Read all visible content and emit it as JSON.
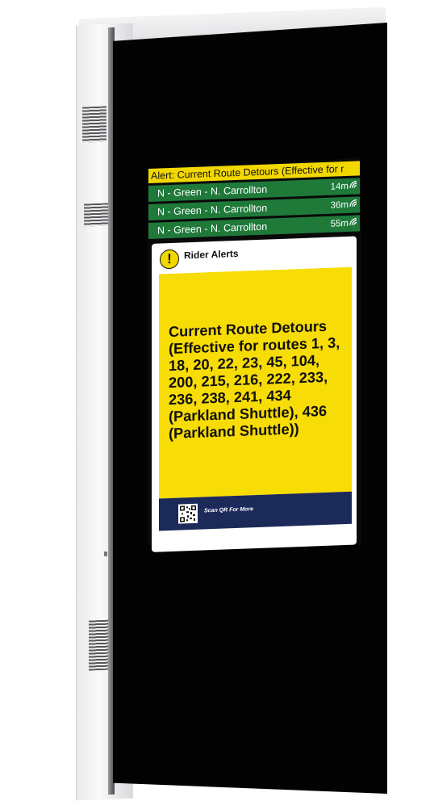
{
  "ticker": {
    "text": "Alert: Current Route Detours (Effective for r"
  },
  "arrivals": [
    {
      "route": "N - Green - N. Carrollton",
      "eta": "14m"
    },
    {
      "route": "N - Green - N. Carrollton",
      "eta": "36m"
    },
    {
      "route": "N - Green - N. Carrollton",
      "eta": "55m"
    }
  ],
  "card": {
    "title": "Rider Alerts",
    "icon_glyph": "!",
    "message": "Current Route Detours (Effective for routes 1, 3, 18, 20, 22, 23, 45, 104, 200, 215, 216, 222, 233, 236, 238, 241, 434 (Parkland Shuttle), 436 (Parkland Shuttle))",
    "footer_text": "Scan QR  For More"
  },
  "colors": {
    "ticker_bg": "#f2d800",
    "arrival_bg": "#1f7a3a",
    "alert_body_bg": "#f7dc06",
    "footer_bg": "#1c2a5a",
    "kiosk_face": "#020202"
  },
  "icons": {
    "realtime": "wifi-signal-icon",
    "alert": "exclamation-icon",
    "qr": "qr-code-icon"
  }
}
